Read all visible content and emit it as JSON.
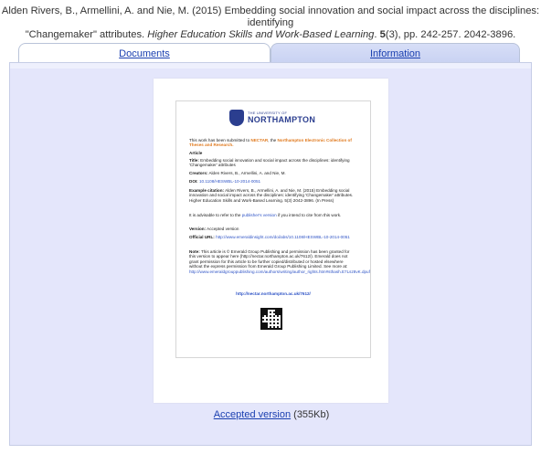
{
  "citation": {
    "line1": "Alden Rivers, B., Armellini, A. and Nie, M. (2015) Embedding social innovation and social impact across the disciplines: identifying",
    "line2_prefix": "\"Changemaker\" attributes.",
    "journal": "Higher Education Skills and Work-Based Learning",
    "volume_pre": ". ",
    "volume": "5",
    "pages": "(3), pp. 242-257. 2042-3896."
  },
  "tabs": [
    {
      "label": "Documents",
      "active": true
    },
    {
      "label": "Information",
      "active": false
    }
  ],
  "document_preview": {
    "logo_small": "THE UNIVERSITY OF",
    "logo_big": "NORTHAMPTON",
    "submitted_prefix": "This work has been submitted to ",
    "submitted_nectar": "NECTAR",
    "submitted_mid": ", the ",
    "submitted_collection": "Northampton Electronic Collection of Theses and Research.",
    "article_label": "Article",
    "title_label": "Title:",
    "title_text": " Embedding social innovation and social impact across the disciplines: identifying 'Changemaker' attributes",
    "creators_label": "Creators:",
    "creators_text": " Alden Rivers, B., Armellini, A. and Nie, M.",
    "doi_label": "DOI:",
    "doi_text": " 10.1108/HESWBL-10-2014-0051",
    "example_label": "Example citation:",
    "example_text": " Alden Rivers, B., Armellini, A. and Nie, M. (2015) Embedding social innovation and social impact across the disciplines: identifying 'Changemaker' attributes. Higher Education Skills and Work-Based Learning. 5(3) 2042-3896. (In Press)",
    "advisable_pre": "It is advisable to refer to the ",
    "advisable_link": "publisher's version",
    "advisable_post": " if you intend to cite from this work.",
    "version_label": "Version:",
    "version_text": " Accepted version",
    "official_label": "Official URL:",
    "official_text": " http://www.emeraldinsight.com/doi/abs/10.1108/HESWBL-10-2014-0051",
    "note_label": "Note:",
    "note_text": " This article is © Emerald Group Publishing and permission has been granted for this version to appear here (http://nectar.northampton.ac.uk/7612/). Emerald does not grant permission for this article to be further copied/distributed or hosted elsewhere without the express permission from Emerald Group Publishing Limited.    See more at:",
    "note_link": "http://www.emeraldgrouppublishing.com/authors/writing/author_rights.htm#sthash.E7Lsz8vK.dpuf",
    "nectar_url": "http://nectar.northampton.ac.uk/7612/"
  },
  "accepted": {
    "link": "Accepted version",
    "size": " (355Kb)"
  }
}
